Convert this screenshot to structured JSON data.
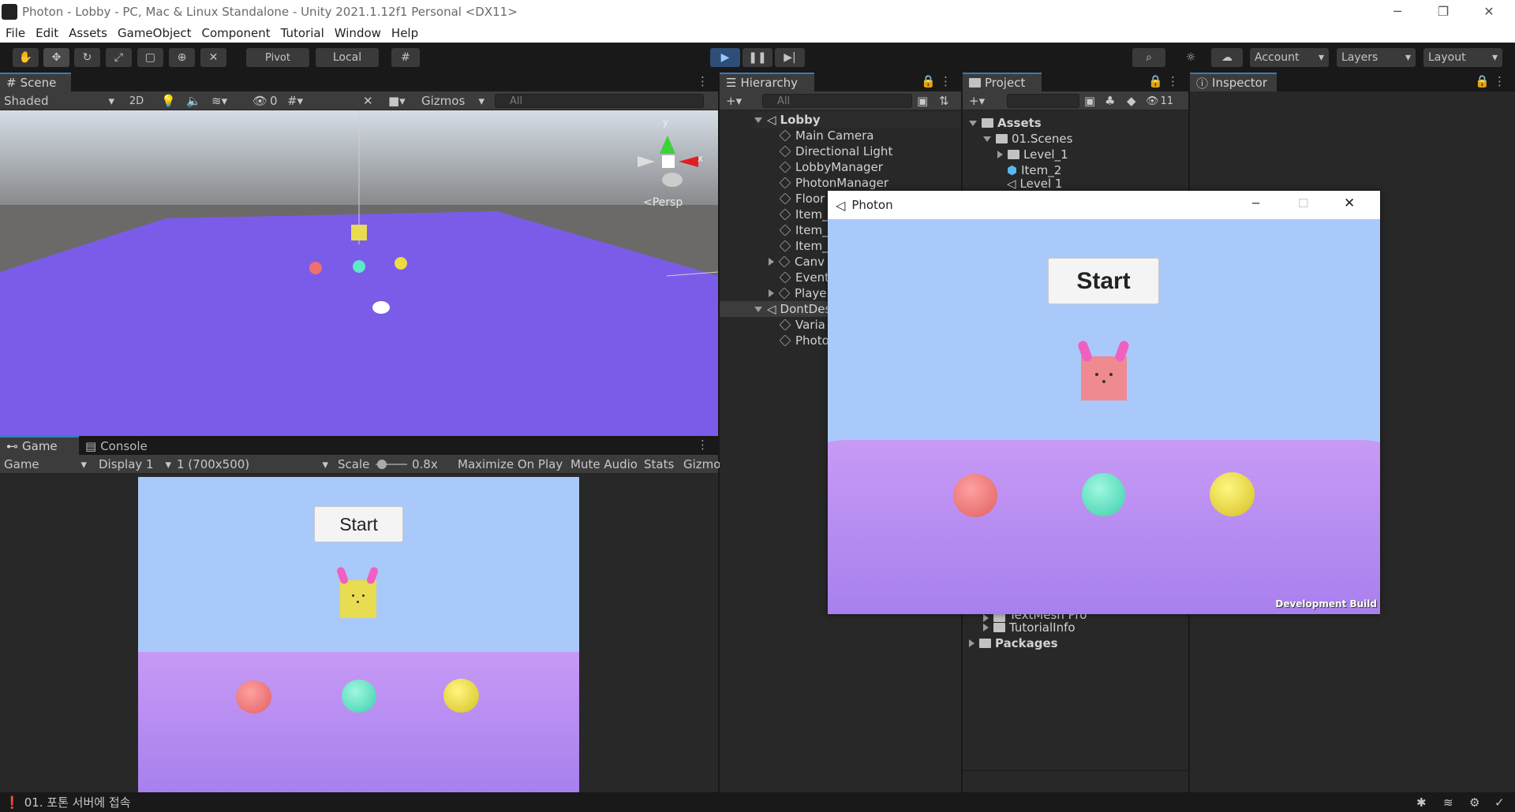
{
  "window": {
    "title": "Photon - Lobby - PC, Mac & Linux Standalone - Unity 2021.1.12f1 Personal <DX11>",
    "min": "─",
    "restore": "❐",
    "close": "✕"
  },
  "menu": [
    "File",
    "Edit",
    "Assets",
    "GameObject",
    "Component",
    "Tutorial",
    "Window",
    "Help"
  ],
  "toolbar": {
    "pivot": "Pivot",
    "local": "Local",
    "account": "Account",
    "layers": "Layers",
    "layout": "Layout"
  },
  "scene": {
    "tab": "Scene",
    "shading": "Shaded",
    "mode2d": "2D",
    "hidden_count": "0",
    "gizmos": "Gizmos",
    "search_placeholder": "All",
    "persp_label": "Persp",
    "axis_y": "y",
    "axis_x": "x"
  },
  "game": {
    "tab_game": "Game",
    "tab_console": "Console",
    "mode": "Game",
    "display": "Display 1",
    "resolution": "1 (700x500)",
    "scale_label": "Scale",
    "scale_value": "0.8x",
    "maximize": "Maximize On Play",
    "mute": "Mute Audio",
    "stats": "Stats",
    "gizmos": "Gizmo",
    "start_label": "Start"
  },
  "hierarchy": {
    "tab": "Hierarchy",
    "search_placeholder": "All",
    "scene_name": "Lobby",
    "items": [
      "Main Camera",
      "Directional Light",
      "LobbyManager",
      "PhotonManager",
      "Floor",
      "Item_",
      "Item_",
      "Item_",
      "Canv",
      "Event",
      "Playe"
    ],
    "dontdestroy": "DontDes",
    "dd_items": [
      "Varia",
      "Photo"
    ]
  },
  "project": {
    "tab": "Project",
    "hidden_count": "11",
    "assets": "Assets",
    "folders": [
      "01.Scenes",
      "Level_1",
      "Item_2",
      "Level 1"
    ],
    "bottom_items": [
      "TextMesh Pro",
      "TutorialInfo",
      "Packages"
    ]
  },
  "inspector": {
    "tab": "Inspector"
  },
  "photon_window": {
    "title": "Photon",
    "start_label": "Start",
    "dev_build": "Development Build"
  },
  "status": {
    "message": "01. 포톤 서버에 접속"
  },
  "colors": {
    "sky": "#a9c9fa",
    "floor": "#b080f0",
    "scene_floor": "#7b5ce8",
    "accent": "#3a79bb",
    "ball_pink": "#ee8080",
    "ball_teal": "#5ee8c8",
    "ball_yellow": "#ecdc40",
    "bunny_yellow": "#e8dc50",
    "bunny_pink": "#ef8a90",
    "ears": "#f060c0"
  }
}
